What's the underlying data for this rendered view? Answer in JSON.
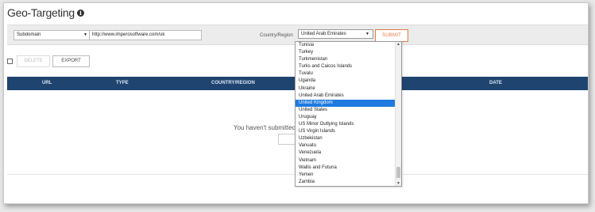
{
  "header": {
    "title": "Geo-Targeting"
  },
  "form": {
    "subdomain_select": "Subdomain",
    "url_value": "http://www.imperosoftware.com/uk",
    "country_label": "Country/Region",
    "country_select": "United Arab Emirates",
    "submit_label": "SUBMIT"
  },
  "toolbar": {
    "delete_label": "DELETE",
    "export_label": "EXPORT"
  },
  "table": {
    "headers": [
      "URL",
      "TYPE",
      "COUNTRY/REGION",
      "DATE"
    ]
  },
  "empty_state": {
    "message": "You haven't submitted c",
    "submit_label": "SUBM"
  },
  "dropdown": {
    "items": [
      "Tunisia",
      "Turkey",
      "Turkmenistan",
      "Turks and Caicos Islands",
      "Tuvalu",
      "Uganda",
      "Ukraine",
      "United Arab Emirates",
      "United Kingdom",
      "United States",
      "Uruguay",
      "US Minor Outlying Islands",
      "US Virgin Islands",
      "Uzbekistan",
      "Vanuatu",
      "Venezuela",
      "Vietnam",
      "Wallis and Futuna",
      "Yemen",
      "Zambia"
    ],
    "highlighted": "United Kingdom"
  },
  "colors": {
    "accent": "#e27a43",
    "table_header": "#1f4470",
    "selection": "#1e7ae0"
  }
}
